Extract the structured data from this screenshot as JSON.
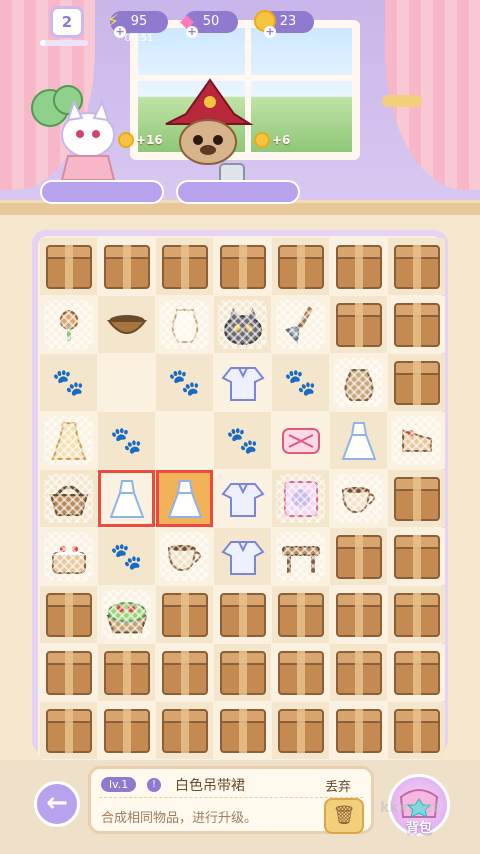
{
  "hud": {
    "player_level": "2",
    "level_progress": 0.1,
    "energy": "95",
    "energy_timer": "00:51",
    "gems": "50",
    "coins": "23"
  },
  "characters": [
    {
      "name": "cat-clover-girl",
      "coin_reward": "+16"
    },
    {
      "name": "witch-kitten",
      "coin_reward": "+6"
    }
  ],
  "board": {
    "rows": [
      [
        "box",
        "box",
        "box",
        "box",
        "box",
        "box",
        "box"
      ],
      [
        "tulip",
        "bowl",
        "jug",
        "cat",
        "shovel",
        "box",
        "box"
      ],
      [
        "paw",
        "empty",
        "paw",
        "shirt",
        "paw",
        "sack",
        "box"
      ],
      [
        "dress-gold",
        "paw",
        "empty",
        "paw",
        "pillow",
        "dress-white",
        "cake-slice"
      ],
      [
        "basket",
        "dress-white-sel",
        "dress-white-sel2",
        "shirt",
        "frame",
        "teacup",
        "box"
      ],
      [
        "cake",
        "paw",
        "teacup",
        "shirt",
        "table",
        "box",
        "box"
      ],
      [
        "box",
        "cake-big",
        "box",
        "box",
        "box",
        "box",
        "box"
      ],
      [
        "box",
        "box",
        "box",
        "box",
        "box",
        "box",
        "box"
      ],
      [
        "box",
        "box",
        "box",
        "box",
        "box",
        "box",
        "box"
      ]
    ]
  },
  "info": {
    "level": "lv.1",
    "name": "白色吊带裙",
    "desc": "合成相同物品，进行升级。"
  },
  "discard": {
    "label": "丢弃"
  },
  "bag": {
    "label": "背包"
  },
  "watermark": "kkx.net"
}
